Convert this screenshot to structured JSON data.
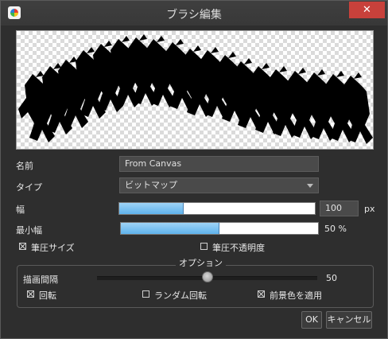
{
  "window": {
    "title": "ブラシ編集",
    "close_label": "✕"
  },
  "form": {
    "name_label": "名前",
    "name_value": "From Canvas",
    "type_label": "タイプ",
    "type_value": "ビットマップ",
    "width_label": "幅",
    "width_fraction": 0.33,
    "width_value": "100",
    "width_unit": "px",
    "min_width_label": "最小幅",
    "min_width_fraction": 0.5,
    "min_width_value": "50 %",
    "pen_size_label": "筆圧サイズ",
    "pen_size_checked": true,
    "pen_opacity_label": "筆圧不透明度",
    "pen_opacity_checked": false
  },
  "options": {
    "title": "オプション",
    "spacing_label": "描画間隔",
    "spacing_value": "50",
    "spacing_fraction": 0.5,
    "rotate_label": "回転",
    "rotate_checked": true,
    "random_rotate_label": "ランダム回転",
    "random_rotate_checked": false,
    "apply_fg_label": "前景色を適用",
    "apply_fg_checked": true
  },
  "buttons": {
    "ok_label": "OK",
    "cancel_label": "キャンセル"
  },
  "icons": {
    "app": "paint-palette-icon",
    "close": "close-icon",
    "dropdown": "chevron-down-icon"
  }
}
